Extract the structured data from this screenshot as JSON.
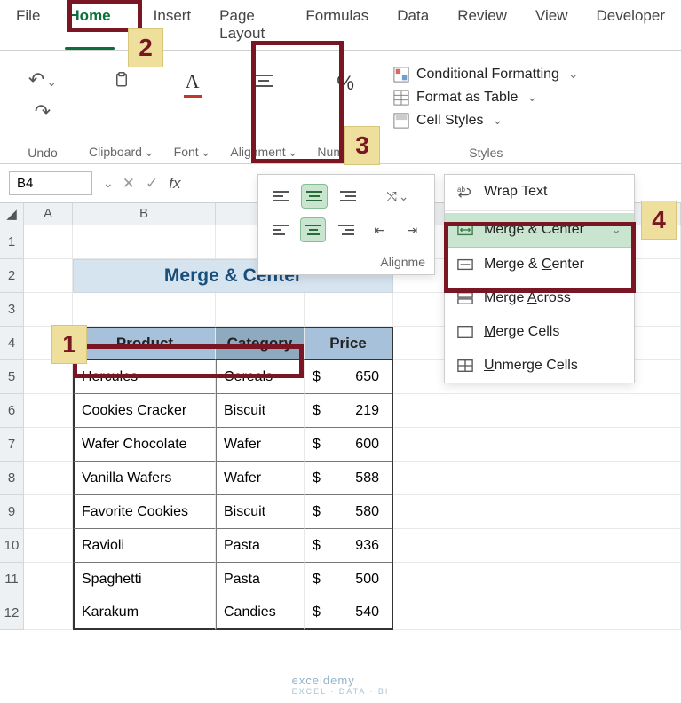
{
  "ribbon": {
    "tabs": {
      "file": "File",
      "home": "Home",
      "insert": "Insert",
      "pageLayout": "Page Layout",
      "formulas": "Formulas",
      "data": "Data",
      "review": "Review",
      "view": "View",
      "developer": "Developer"
    },
    "groups": {
      "undo": "Undo",
      "clipboard": "Clipboard",
      "font": "Font",
      "alignment": "Alignment",
      "number": "Number",
      "styles": "Styles"
    },
    "styles": {
      "cond": "Conditional Formatting",
      "table": "Format as Table",
      "cell": "Cell Styles"
    }
  },
  "formula_bar": {
    "name_box": "B4"
  },
  "alignment_panel": {
    "label": "Alignme"
  },
  "merge_menu": {
    "wrap": "Wrap Text",
    "header": "Merge & Center",
    "items": {
      "mergeCenter": "Merge & Center",
      "mergeAcross": "Merge Across",
      "mergeCells": "Merge Cells",
      "unmerge": "Unmerge Cells"
    },
    "accel": {
      "mC": "C",
      "mA": "A",
      "mM": "M",
      "mU": "U"
    }
  },
  "sheet": {
    "columns": {
      "A": "A",
      "B": "B"
    },
    "title": "Merge & Center",
    "headers": {
      "product": "Product",
      "category": "Category",
      "price": "Price"
    },
    "currency": "$",
    "rows": [
      {
        "product": "Hercules",
        "category": "Cereals",
        "price": "650"
      },
      {
        "product": "Cookies Cracker",
        "category": "Biscuit",
        "price": "219"
      },
      {
        "product": "Wafer Chocolate",
        "category": "Wafer",
        "price": "600"
      },
      {
        "product": "Vanilla Wafers",
        "category": "Wafer",
        "price": "588"
      },
      {
        "product": "Favorite Cookies",
        "category": "Biscuit",
        "price": "580"
      },
      {
        "product": "Ravioli",
        "category": "Pasta",
        "price": "936"
      },
      {
        "product": "Spaghetti",
        "category": "Pasta",
        "price": "500"
      },
      {
        "product": "Karakum",
        "category": "Candies",
        "price": "540"
      }
    ]
  },
  "callouts": {
    "c1": "1",
    "c2": "2",
    "c3": "3",
    "c4": "4"
  },
  "watermark": {
    "main": "exceldemy",
    "sub": "EXCEL · DATA · BI"
  }
}
